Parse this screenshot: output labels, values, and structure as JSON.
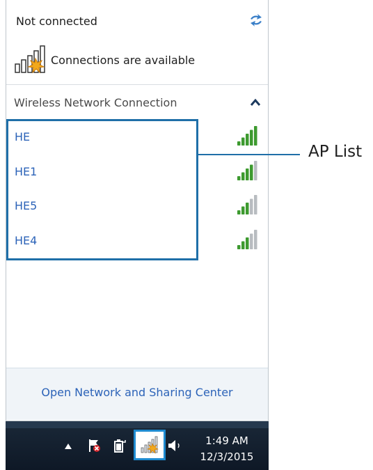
{
  "flyout": {
    "status": "Not connected",
    "availability": "Connections are available",
    "section_title": "Wireless Network Connection",
    "networks": [
      {
        "name": "HE",
        "signal": 5
      },
      {
        "name": "HE1",
        "signal": 4
      },
      {
        "name": "HE5",
        "signal": 3
      },
      {
        "name": "HE4",
        "signal": 3
      }
    ],
    "footer_link": "Open Network and Sharing Center"
  },
  "callout": {
    "label": "AP List"
  },
  "taskbar": {
    "time": "1:49 AM",
    "date": "12/3/2015"
  },
  "colors": {
    "link": "#2c63b8",
    "highlight": "#1f6fa8",
    "signal_green": "#3d9a2f",
    "signal_gray": "#b8bcc0",
    "taskbar": "#13202f"
  }
}
